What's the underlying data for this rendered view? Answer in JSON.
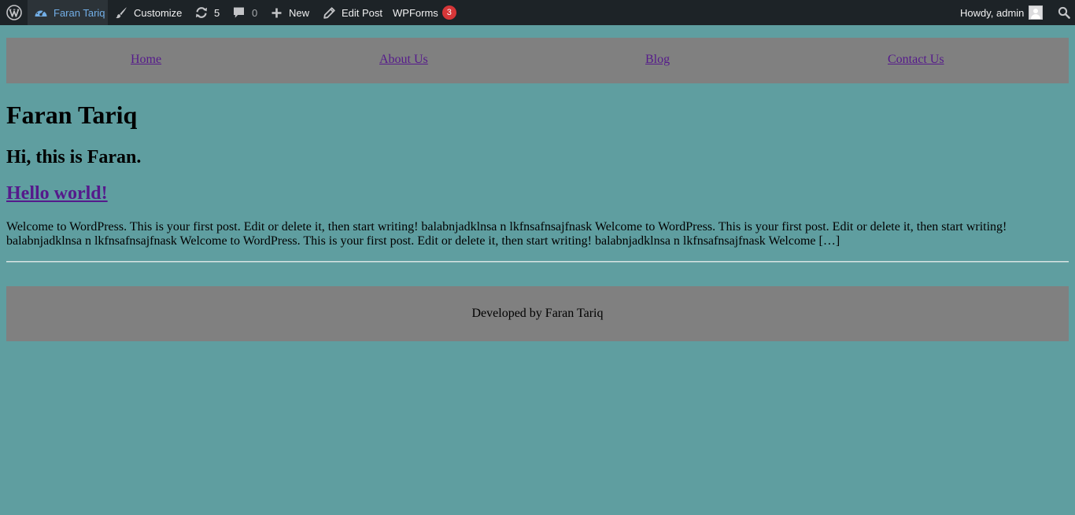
{
  "admin_bar": {
    "site_name": "Faran Tariq",
    "customize_label": "Customize",
    "updates_count": "5",
    "comments_count": "0",
    "new_label": "New",
    "edit_post_label": "Edit Post",
    "wpforms_label": "WPForms",
    "wpforms_badge": "3",
    "greeting": "Howdy, admin",
    "icons": [
      "wordpress-logo-icon",
      "dashboard-icon",
      "paintbrush-icon",
      "updates-icon",
      "comment-icon",
      "plus-icon",
      "pencil-icon",
      "user-avatar",
      "search-icon"
    ],
    "colors": {
      "bar_bg": "#1d2327",
      "active_bg": "#2c3338",
      "active_text": "#72aee6",
      "badge_bg": "#d63638"
    }
  },
  "nav": {
    "items": [
      {
        "label": "Home"
      },
      {
        "label": "About Us"
      },
      {
        "label": "Blog"
      },
      {
        "label": "Contact Us"
      }
    ]
  },
  "site": {
    "title": "Faran Tariq",
    "tagline": "Hi, this is Faran."
  },
  "post": {
    "title": "Hello world!",
    "excerpt": "Welcome to WordPress. This is your first post. Edit or delete it, then start writing! balabnjadklnsa n lkfnsafnsajfnask Welcome to WordPress. This is your first post. Edit or delete it, then start writing! balabnjadklnsa n lkfnsafnsajfnask Welcome to WordPress. This is your first post. Edit or delete it, then start writing! balabnjadklnsa n lkfnsafnsajfnask Welcome […]"
  },
  "footer": {
    "text": "Developed by Faran Tariq"
  },
  "colors": {
    "page_bg": "#5f9ea0",
    "panel_bg": "#808080",
    "link": "#551a8b"
  }
}
